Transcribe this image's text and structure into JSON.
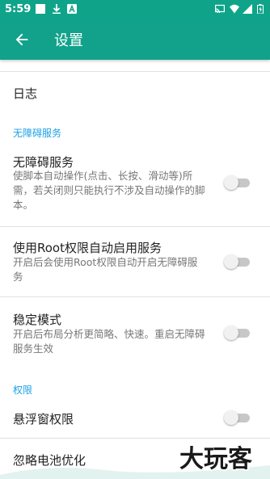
{
  "status_bar": {
    "time": "5:59",
    "icons": [
      "square-notification-icon",
      "download-icon",
      "a-notification-icon",
      "cast-icon",
      "wifi-icon",
      "signal-icon",
      "battery-icon"
    ]
  },
  "app_bar": {
    "title": "设置",
    "back_icon": "arrow-back-icon"
  },
  "items": {
    "log": {
      "title": "日志"
    },
    "accessibility_section": {
      "title": "无障碍服务"
    },
    "accessibility_service": {
      "title": "无障碍服务",
      "summary": "使脚本自动操作(点击、长按、滑动等)所需，若关闭则只能执行不涉及自动操作的脚本。",
      "enabled": false
    },
    "root_auto": {
      "title": "使用Root权限自动启用服务",
      "summary": "开启后会使用Root权限自动开启无障碍服务",
      "enabled": false
    },
    "stable_mode": {
      "title": "稳定模式",
      "summary": "开启后布局分析更简略、快速。重启无障碍服务生效",
      "enabled": false
    },
    "permission_section": {
      "title": "权限"
    },
    "floating_window": {
      "title": "悬浮窗权限",
      "enabled": false
    },
    "battery_opt": {
      "title": "忽略电池优化"
    }
  },
  "watermark": {
    "text": "大玩客"
  },
  "colors": {
    "primary": "#12a28b",
    "status_bar": "#0fa48a",
    "section_header": "#1aa0e6",
    "summary_text": "#777777",
    "divider": "#e0e0e0"
  }
}
